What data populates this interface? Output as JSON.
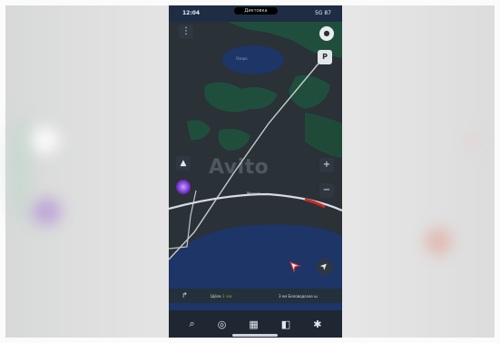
{
  "status": {
    "time": "12:04",
    "pill": "Диктовка",
    "right": "5G 87"
  },
  "map": {
    "lake_label": "Озеро",
    "road_label": "Москва",
    "watermark": "Avito"
  },
  "controls": {
    "menu_icon": "⋮",
    "chat_icon": "●",
    "parking_icon": "P",
    "warning_icon": "▲",
    "zoom_in": "+",
    "zoom_out": "−",
    "locate_icon": "➤"
  },
  "route_bar": {
    "arrow": "↱",
    "text_prefix": "Щёлк",
    "text_highlight": "1 час",
    "text_suffix": "3 км Беловодское ш"
  },
  "tabbar": {
    "search": "⌕",
    "navigator": "◎",
    "map": "▦",
    "layers": "◧",
    "settings": "✱"
  },
  "colors": {
    "accent_green": "#7bc142",
    "water": "#1d3567",
    "forest": "#1f4f3c"
  }
}
